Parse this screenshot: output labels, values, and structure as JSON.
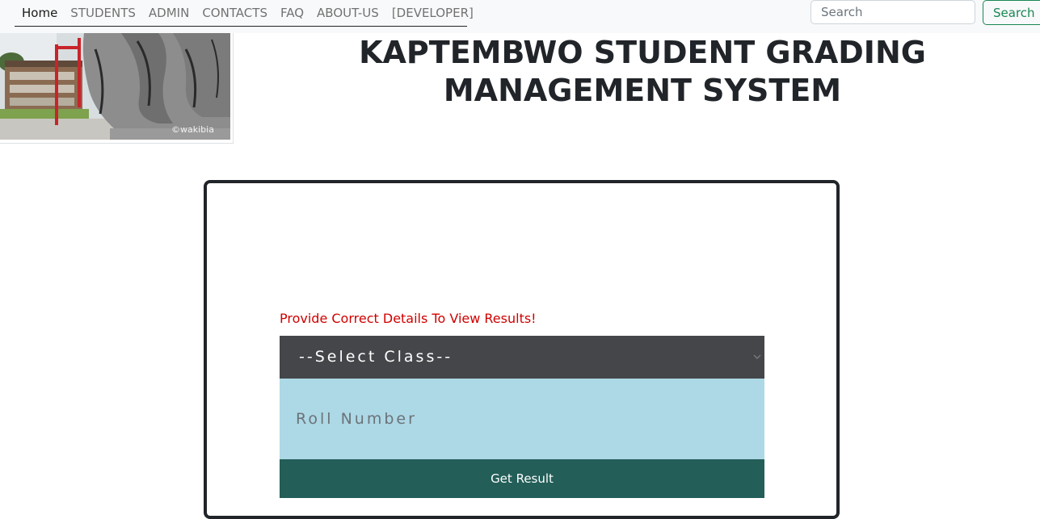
{
  "nav": {
    "items": [
      {
        "label": "Home",
        "active": true
      },
      {
        "label": "STUDENTS"
      },
      {
        "label": "ADMIN"
      },
      {
        "label": "CONTACTS"
      },
      {
        "label": "FAQ"
      },
      {
        "label": "ABOUT-US"
      },
      {
        "label": "[DEVELOPER]"
      }
    ],
    "search_placeholder": "Search",
    "search_button": "Search"
  },
  "logo": {
    "watermark": "©wakibia"
  },
  "header": {
    "title": "KAPTEMBWO STUDENT GRADING MANAGEMENT SYSTEM"
  },
  "form": {
    "error_message": "Provide Correct Details To View Results!",
    "class_select_value": "--Select Class--",
    "roll_placeholder": "Roll Number",
    "submit_label": "Get Result"
  },
  "colors": {
    "error": "#d00000",
    "select_bg": "#454649",
    "roll_bg": "#add8e6",
    "submit_bg": "#235e58",
    "search_accent": "#198754"
  }
}
